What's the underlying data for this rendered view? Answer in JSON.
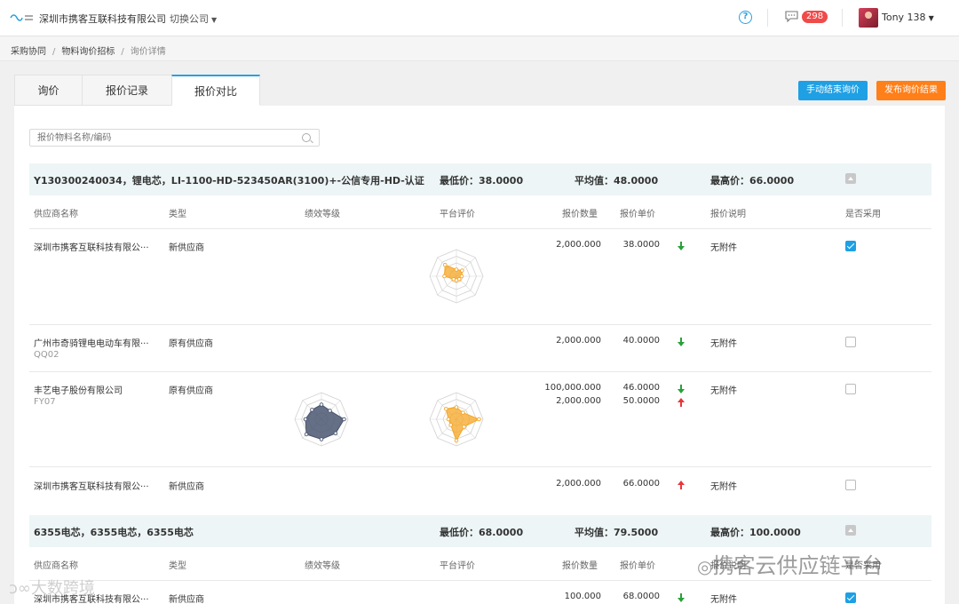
{
  "header": {
    "company": "深圳市携客互联科技有限公司",
    "switch_label": "切换公司",
    "help_icon": "?",
    "message_count": "298",
    "user_name": "Tony 138"
  },
  "breadcrumb": [
    "采购协同",
    "物料询价招标",
    "询价详情"
  ],
  "tabs": [
    {
      "label": "询价",
      "active": false
    },
    {
      "label": "报价记录",
      "active": false
    },
    {
      "label": "报价对比",
      "active": true
    }
  ],
  "actions": {
    "end_label": "手动结束询价",
    "publish_label": "发布询价结果"
  },
  "search": {
    "placeholder": "报价物料名称/编码"
  },
  "columns": [
    "供应商名称",
    "类型",
    "绩效等级",
    "平台评价",
    "报价数量",
    "报价单价",
    "报价说明",
    "是否采用"
  ],
  "groups": [
    {
      "title": "Y130300240034，锂电芯，LI-1100-HD-523450AR(3100)+-公信专用-HD-认证",
      "min_price": "最低价：38.0000",
      "avg_price": "平均值：48.0000",
      "max_price": "最高价：66.0000",
      "rows": [
        {
          "supplier": "深圳市携客互联科技有限公···",
          "code": "",
          "type": "新供应商",
          "quantities": [
            "2,000.000"
          ],
          "prices": [
            "38.0000"
          ],
          "trends": [
            "down"
          ],
          "note": "无附件",
          "adopted": true
        },
        {
          "supplier": "广州市奇骑锂电电动车有限···",
          "code": "QQ02",
          "type": "原有供应商",
          "quantities": [
            "2,000.000"
          ],
          "prices": [
            "40.0000"
          ],
          "trends": [
            "down"
          ],
          "note": "无附件",
          "adopted": false
        },
        {
          "supplier": "丰艺电子股份有限公司",
          "code": "FY07",
          "type": "原有供应商",
          "quantities": [
            "100,000.000",
            "2,000.000"
          ],
          "prices": [
            "46.0000",
            "50.0000"
          ],
          "trends": [
            "down",
            "up"
          ],
          "note": "无附件",
          "adopted": false
        },
        {
          "supplier": "深圳市携客互联科技有限公···",
          "code": "",
          "type": "新供应商",
          "quantities": [
            "2,000.000"
          ],
          "prices": [
            "66.0000"
          ],
          "trends": [
            "up"
          ],
          "note": "无附件",
          "adopted": false
        }
      ]
    },
    {
      "title": "6355电芯，6355电芯，6355电芯",
      "min_price": "最低价：68.0000",
      "avg_price": "平均值：79.5000",
      "max_price": "最高价：100.0000",
      "rows": [
        {
          "supplier": "深圳市携客互联科技有限公···",
          "code": "",
          "type": "新供应商",
          "quantities": [
            "100.000"
          ],
          "prices": [
            "68.0000"
          ],
          "trends": [
            "down"
          ],
          "note": "无附件",
          "adopted": true
        }
      ]
    }
  ],
  "watermarks": {
    "right": "携客云供应链平台",
    "left": "大数跨境"
  },
  "colors": {
    "primary": "#1fa0e4",
    "publish": "#ff7f19",
    "badge": "#f04a4a",
    "radar_orange": "#f5a623",
    "radar_slate": "#4a5670",
    "down": "#2aa03a",
    "up": "#e8363b"
  }
}
